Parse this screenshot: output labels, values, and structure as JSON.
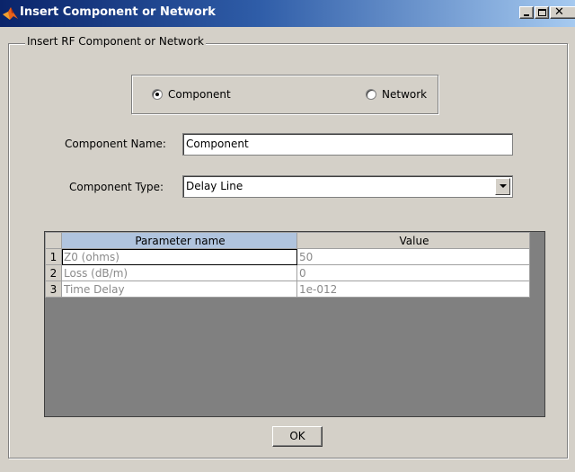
{
  "window": {
    "title": "Insert Component or Network",
    "icon": "matlab-logo-icon",
    "controls": [
      "minimize-icon",
      "maximize-icon",
      "close-icon"
    ]
  },
  "group": {
    "label": "Insert RF Component or Network"
  },
  "mode": {
    "options": [
      {
        "label": "Component",
        "selected": true
      },
      {
        "label": "Network",
        "selected": false
      }
    ]
  },
  "component_name": {
    "label": "Component Name:",
    "value": "Component"
  },
  "component_type": {
    "label": "Component Type:",
    "value": "Delay Line"
  },
  "table": {
    "columns": [
      "Parameter name",
      "Value"
    ],
    "rows": [
      {
        "index": "1",
        "name": "Z0 (ohms)",
        "value": "50"
      },
      {
        "index": "2",
        "name": "Loss (dB/m)",
        "value": "0"
      },
      {
        "index": "3",
        "name": "Time Delay",
        "value": "1e-012"
      }
    ]
  },
  "ok_button": {
    "label": "OK"
  }
}
